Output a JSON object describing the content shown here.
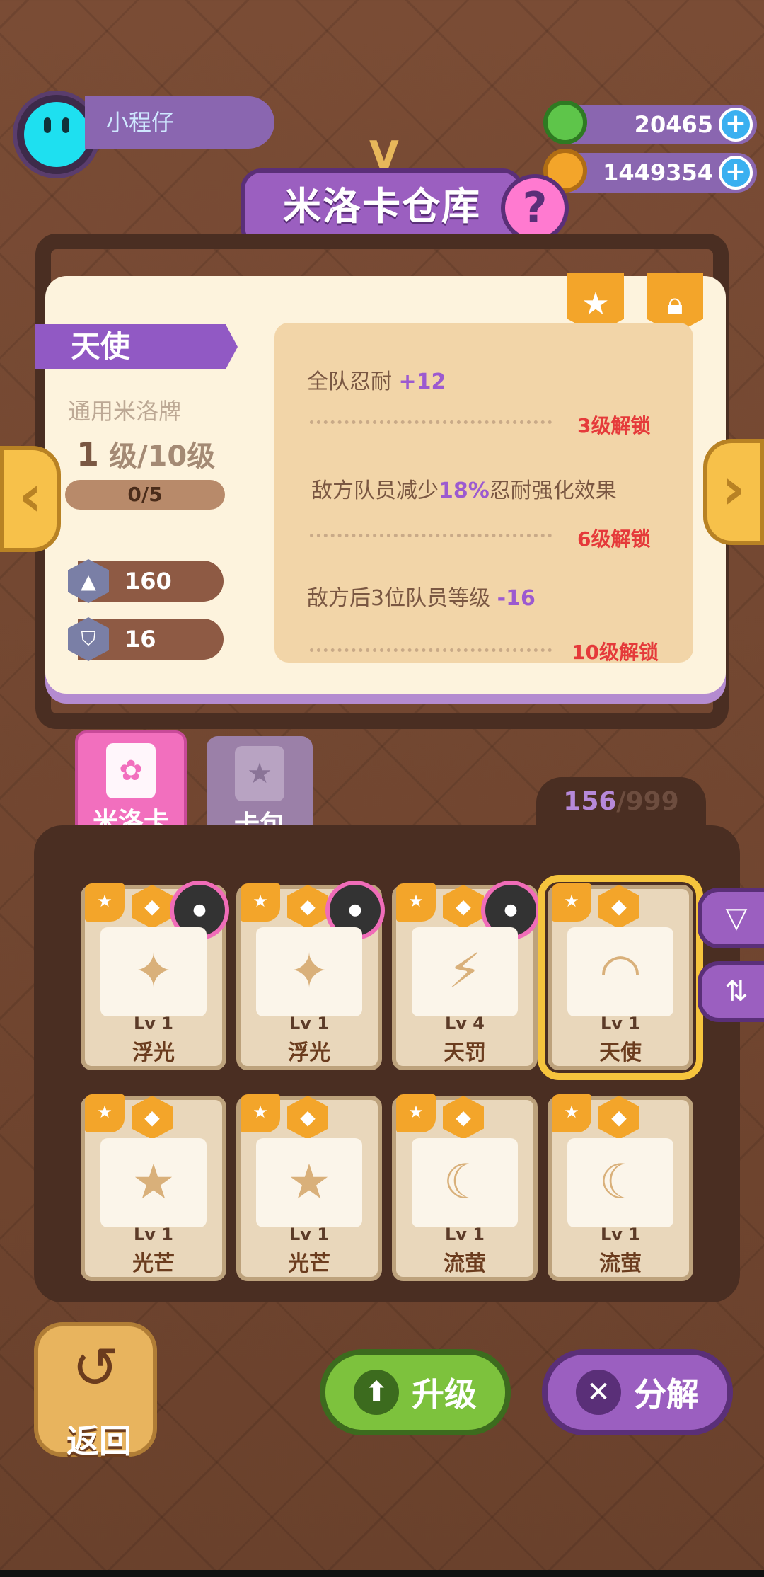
{
  "user": {
    "name": "小程仔"
  },
  "currencies": [
    {
      "name": "green-donut-coin-icon",
      "value": "20465",
      "color": "#5ec54a"
    },
    {
      "name": "gold-planet-coin-icon",
      "value": "1449354",
      "color": "#f3a52a"
    }
  ],
  "title": {
    "text": "米洛卡仓库",
    "help": "?",
    "mark": "V"
  },
  "selected_card": {
    "name": "天使",
    "type": "通用米洛牌",
    "level": "1",
    "level_suffix": "级/10级",
    "xp": "0/5",
    "xp_fraction": 0.0,
    "stats": [
      {
        "icon": "boot-icon",
        "value": "160"
      },
      {
        "icon": "shield-icon",
        "value": "16"
      }
    ],
    "effects": [
      {
        "text": "全队忍耐 ",
        "highlight": "+12",
        "after": "",
        "unlock": "3级解锁"
      },
      {
        "text": "敌方队员减少",
        "highlight": "18%",
        "after": "忍耐强化效果",
        "unlock": "6级解锁"
      },
      {
        "text": "敌方后3位队员等级 ",
        "highlight": "-16",
        "after": "",
        "unlock": "10级解锁"
      }
    ]
  },
  "tabs": [
    {
      "label": "米洛卡",
      "active": true
    },
    {
      "label": "卡包",
      "active": false
    }
  ],
  "inventory": {
    "count": "156",
    "max": "999",
    "sep": "/"
  },
  "cards": [
    {
      "lv": "Lv 1",
      "name": "浮光",
      "glyph": "✦",
      "owner": true,
      "selected": false
    },
    {
      "lv": "Lv 1",
      "name": "浮光",
      "glyph": "✦",
      "owner": true,
      "selected": false
    },
    {
      "lv": "Lv 4",
      "name": "天罚",
      "glyph": "⚡",
      "owner": true,
      "selected": false
    },
    {
      "lv": "Lv 1",
      "name": "天使",
      "glyph": "◠",
      "owner": false,
      "selected": true
    },
    {
      "lv": "Lv 1",
      "name": "光芒",
      "glyph": "★",
      "owner": false,
      "selected": false
    },
    {
      "lv": "Lv 1",
      "name": "光芒",
      "glyph": "★",
      "owner": false,
      "selected": false
    },
    {
      "lv": "Lv 1",
      "name": "流萤",
      "glyph": "☾",
      "owner": false,
      "selected": false
    },
    {
      "lv": "Lv 1",
      "name": "流萤",
      "glyph": "☾",
      "owner": false,
      "selected": false
    }
  ],
  "buttons": {
    "back": "返回",
    "upgrade": "升级",
    "decompose": "分解"
  }
}
